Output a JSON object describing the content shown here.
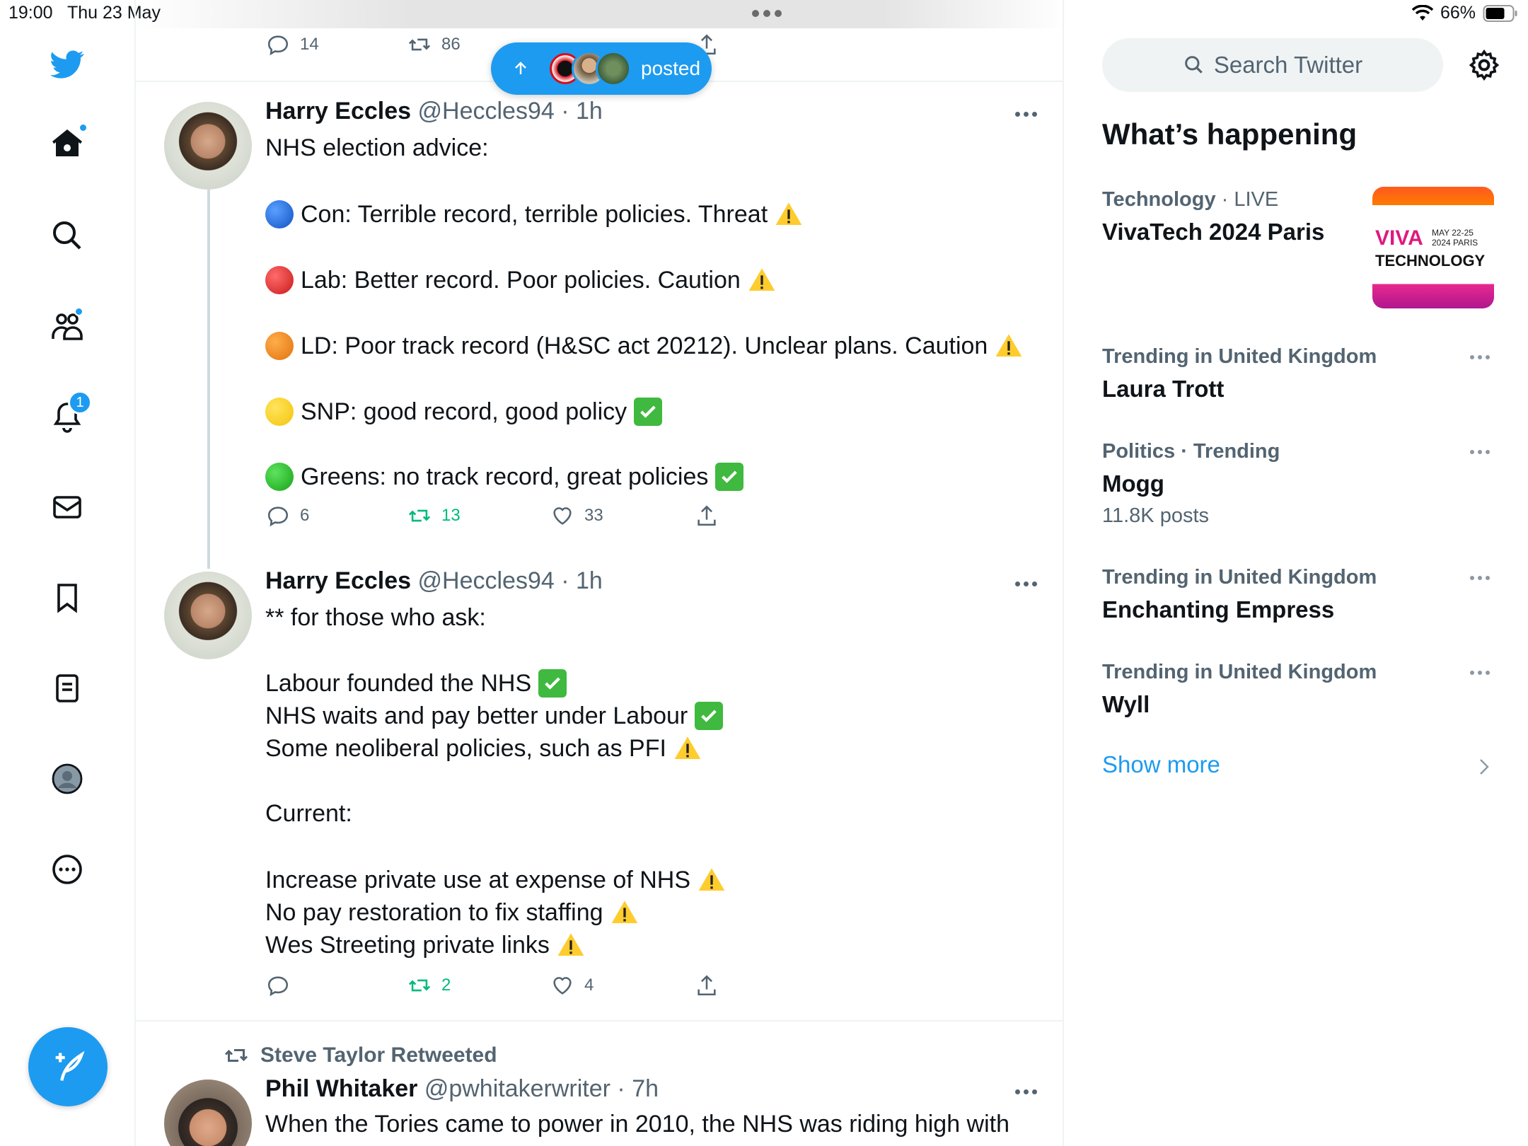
{
  "status_bar": {
    "time": "19:00",
    "date": "Thu 23 May",
    "battery": "66%"
  },
  "posted_pill": {
    "label": "posted"
  },
  "partial_tweet": {
    "replies": "14",
    "retweets": "86"
  },
  "tweets": [
    {
      "name": "Harry Eccles",
      "handle": "@Heccles94",
      "time": "· 1h",
      "lines": [
        "NHS election advice:",
        "Con: Terrible record, terrible policies. Threat",
        "Lab: Better record. Poor policies. Caution",
        "LD: Poor track record (H&SC act 20212). Unclear plans. Caution",
        "SNP: good record, good policy",
        "Greens: no track record, great policies"
      ],
      "replies": "6",
      "retweets": "13",
      "likes": "33"
    },
    {
      "name": "Harry Eccles",
      "handle": "@Heccles94",
      "time": "· 1h",
      "lines": [
        "** for those who ask:",
        "Labour founded the NHS",
        "NHS waits and pay better under Labour",
        "Some neoliberal policies, such as PFI",
        "Current:",
        "Increase private use at expense of NHS",
        "No pay restoration to fix staffing",
        "Wes Streeting private links"
      ],
      "replies": "",
      "retweets": "2",
      "likes": "4"
    },
    {
      "retweeted_by": "Steve Taylor Retweeted",
      "name": "Phil Whitaker",
      "handle": "@pwhitakerwriter",
      "time": "· 7h",
      "lines": [
        "When the Tories came to power in 2010, the NHS was riding high with"
      ]
    }
  ],
  "sidebar": {
    "search_placeholder": "Search Twitter",
    "title": "What’s happening",
    "trends": [
      {
        "category": "Technology",
        "extra": " · LIVE",
        "title": "VivaTech 2024 Paris",
        "count": ""
      },
      {
        "category": "Trending in United Kingdom",
        "extra": "",
        "title": "Laura Trott",
        "count": ""
      },
      {
        "category": "Politics · Trending",
        "extra": "",
        "title": "Mogg",
        "count": "11.8K posts"
      },
      {
        "category": "Trending in United Kingdom",
        "extra": "",
        "title": "Enchanting Empress",
        "count": ""
      },
      {
        "category": "Trending in United Kingdom",
        "extra": "",
        "title": "Wyll",
        "count": ""
      }
    ],
    "show_more": "Show more",
    "viva_image": {
      "brand": "VIVA",
      "dates": "MAY 22-25",
      "sub": "2024 PARIS",
      "word": "TECHNOLOGY"
    }
  },
  "colors": {
    "accent": "#1d9bf0",
    "retweet_green": "#00ba7c",
    "text_secondary": "#536471"
  },
  "icons": [
    "twitter-logo-icon",
    "home-icon",
    "search-icon",
    "communities-icon",
    "bell-icon",
    "mail-icon",
    "bookmark-icon",
    "lists-icon",
    "profile-icon",
    "more-icon",
    "compose-icon",
    "reply-icon",
    "retweet-icon",
    "like-icon",
    "share-icon",
    "gear-icon"
  ]
}
